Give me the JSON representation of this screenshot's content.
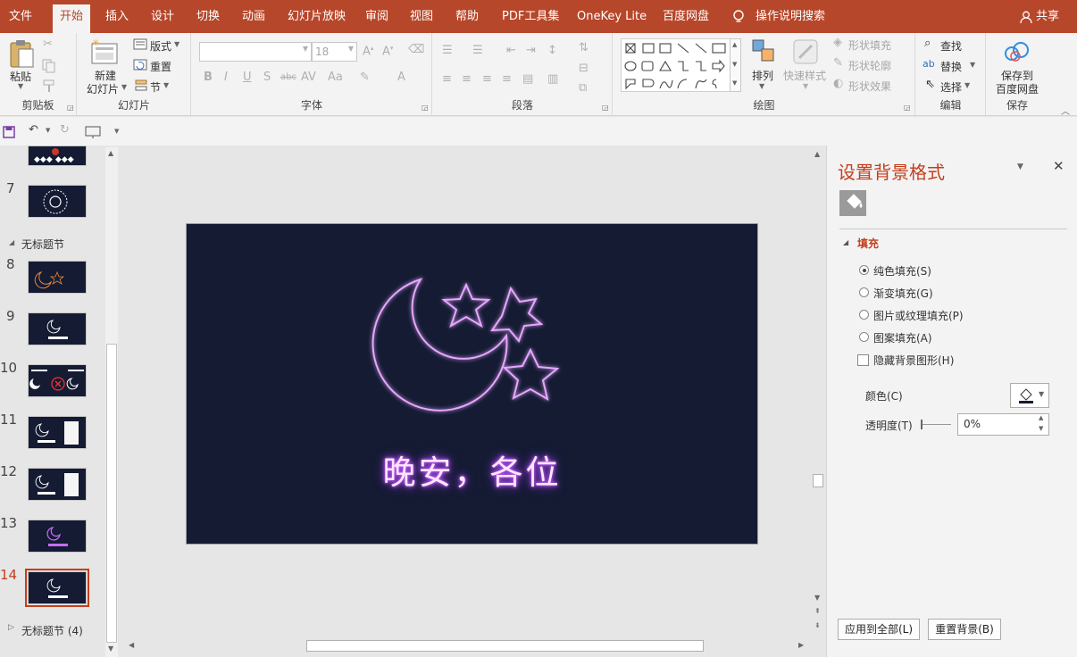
{
  "tabs": [
    "文件",
    "开始",
    "插入",
    "设计",
    "切换",
    "动画",
    "幻灯片放映",
    "审阅",
    "视图",
    "帮助",
    "PDF工具集",
    "OneKey Lite",
    "百度网盘",
    "操作说明搜索"
  ],
  "share_label": "共享",
  "ribbon": {
    "clipboard": {
      "paste": "粘贴",
      "label": "剪贴板"
    },
    "slides": {
      "new_slide_1": "新建",
      "new_slide_2": "幻灯片",
      "layout": "版式",
      "reset": "重置",
      "section": "节",
      "label": "幻灯片"
    },
    "font": {
      "size": "18",
      "label": "字体"
    },
    "paragraph": {
      "label": "段落"
    },
    "drawing": {
      "arrange": "排列",
      "quick_styles": "快速样式",
      "shape_fill": "形状填充",
      "shape_outline": "形状轮廓",
      "shape_effects": "形状效果",
      "label": "绘图"
    },
    "editing": {
      "find": "查找",
      "replace": "替换",
      "select": "选择",
      "label": "编辑"
    },
    "save": {
      "line1": "保存到",
      "line2": "百度网盘",
      "label": "保存"
    }
  },
  "thumbnails": [
    {
      "num": "7"
    },
    {
      "section": "无标题节"
    },
    {
      "num": "8"
    },
    {
      "num": "9"
    },
    {
      "num": "10"
    },
    {
      "num": "11"
    },
    {
      "num": "12"
    },
    {
      "num": "13"
    },
    {
      "num": "14"
    }
  ],
  "section_label": "无标题节",
  "bottom_section_label": "无标题节 (4)",
  "slide": {
    "title": "晚安，各位",
    "bg_color": "#141b33",
    "neon_color": "#cc55ff"
  },
  "pane": {
    "title": "设置背景格式",
    "fill_header": "填充",
    "options": [
      "纯色填充(S)",
      "渐变填充(G)",
      "图片或纹理填充(P)",
      "图案填充(A)"
    ],
    "selected_option": "纯色填充(S)",
    "hide_bg": "隐藏背景图形(H)",
    "color_label": "颜色(C)",
    "transparency_label": "透明度(T)",
    "transparency_value": "0%",
    "apply_all": "应用到全部(L)",
    "reset_bg": "重置背景(B)"
  }
}
